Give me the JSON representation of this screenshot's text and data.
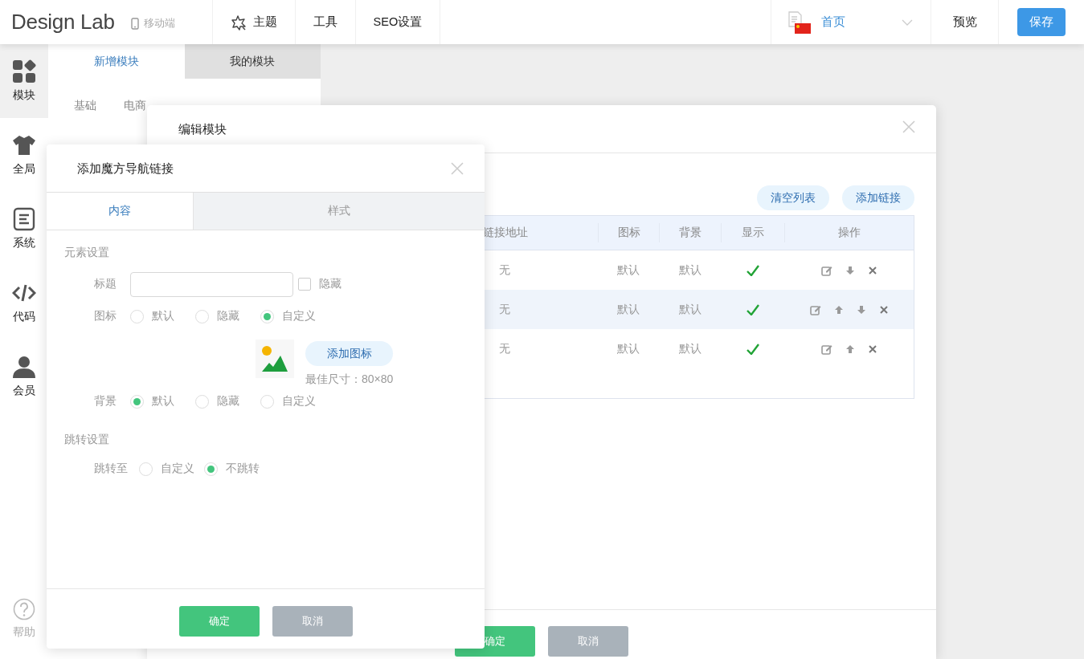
{
  "header": {
    "logo": "Design Lab",
    "device": "移动端",
    "nav": [
      {
        "label": "主题"
      },
      {
        "label": "工具"
      },
      {
        "label": "SEO设置"
      }
    ],
    "page_select": {
      "value": "首页"
    },
    "preview": "预览",
    "save": "保存"
  },
  "sidebar": {
    "items": [
      {
        "label": "模块",
        "selected": true
      },
      {
        "label": "全局",
        "selected": false
      },
      {
        "label": "系统",
        "selected": false
      },
      {
        "label": "代码",
        "selected": false
      },
      {
        "label": "会员",
        "selected": false
      }
    ],
    "help": "帮助"
  },
  "module_panel": {
    "tabs": [
      {
        "label": "新增模块",
        "selected": true
      },
      {
        "label": "我的模块",
        "selected": false
      }
    ],
    "categories": [
      {
        "label": "基础",
        "selected": false
      },
      {
        "label": "电商",
        "selected": false
      }
    ]
  },
  "edit_dialog": {
    "title": "编辑模块",
    "toolbar": [
      "清空列表",
      "添加链接"
    ],
    "table": {
      "columns": [
        "链接地址",
        "图标",
        "背景",
        "显示",
        "操作"
      ],
      "rows": [
        {
          "link": "无",
          "icon": "默认",
          "background": "默认",
          "shown": true,
          "highlighted": false,
          "can_move_up": false,
          "can_move_down": true
        },
        {
          "link": "无",
          "icon": "默认",
          "background": "默认",
          "shown": true,
          "highlighted": true,
          "can_move_up": true,
          "can_move_down": true
        },
        {
          "link": "无",
          "icon": "默认",
          "background": "默认",
          "shown": true,
          "highlighted": false,
          "can_move_up": true,
          "can_move_down": false
        }
      ]
    },
    "buttons": [
      {
        "label": "确定",
        "kind": "primary"
      },
      {
        "label": "取消",
        "kind": "secondary"
      }
    ]
  },
  "link_dialog": {
    "title": "添加魔方导航链接",
    "tabs": [
      {
        "label": "内容",
        "selected": true
      },
      {
        "label": "样式",
        "selected": false
      }
    ],
    "sections": [
      {
        "heading": "元素设置",
        "fields": [
          {
            "kind": "text",
            "label": "标题",
            "checkbox": {
              "label": "隐藏",
              "checked": false
            }
          },
          {
            "kind": "radio",
            "label": "图标",
            "options": [
              {
                "label": "默认",
                "selected": false
              },
              {
                "label": "隐藏",
                "selected": false
              },
              {
                "label": "自定义",
                "selected": true
              }
            ]
          },
          {
            "kind": "image",
            "button": "添加图标",
            "hint": "最佳尺寸：80×80"
          },
          {
            "kind": "radio",
            "label": "背景",
            "options": [
              {
                "label": "默认",
                "selected": true
              },
              {
                "label": "隐藏",
                "selected": false
              },
              {
                "label": "自定义",
                "selected": false
              }
            ]
          }
        ]
      },
      {
        "heading": "跳转设置",
        "fields": [
          {
            "kind": "radio",
            "label": "跳转至",
            "options": [
              {
                "label": "自定义",
                "selected": false
              },
              {
                "label": "不跳转",
                "selected": true
              }
            ]
          }
        ]
      }
    ],
    "buttons": [
      {
        "label": "确定",
        "kind": "primary"
      },
      {
        "label": "取消",
        "kind": "secondary"
      }
    ]
  }
}
